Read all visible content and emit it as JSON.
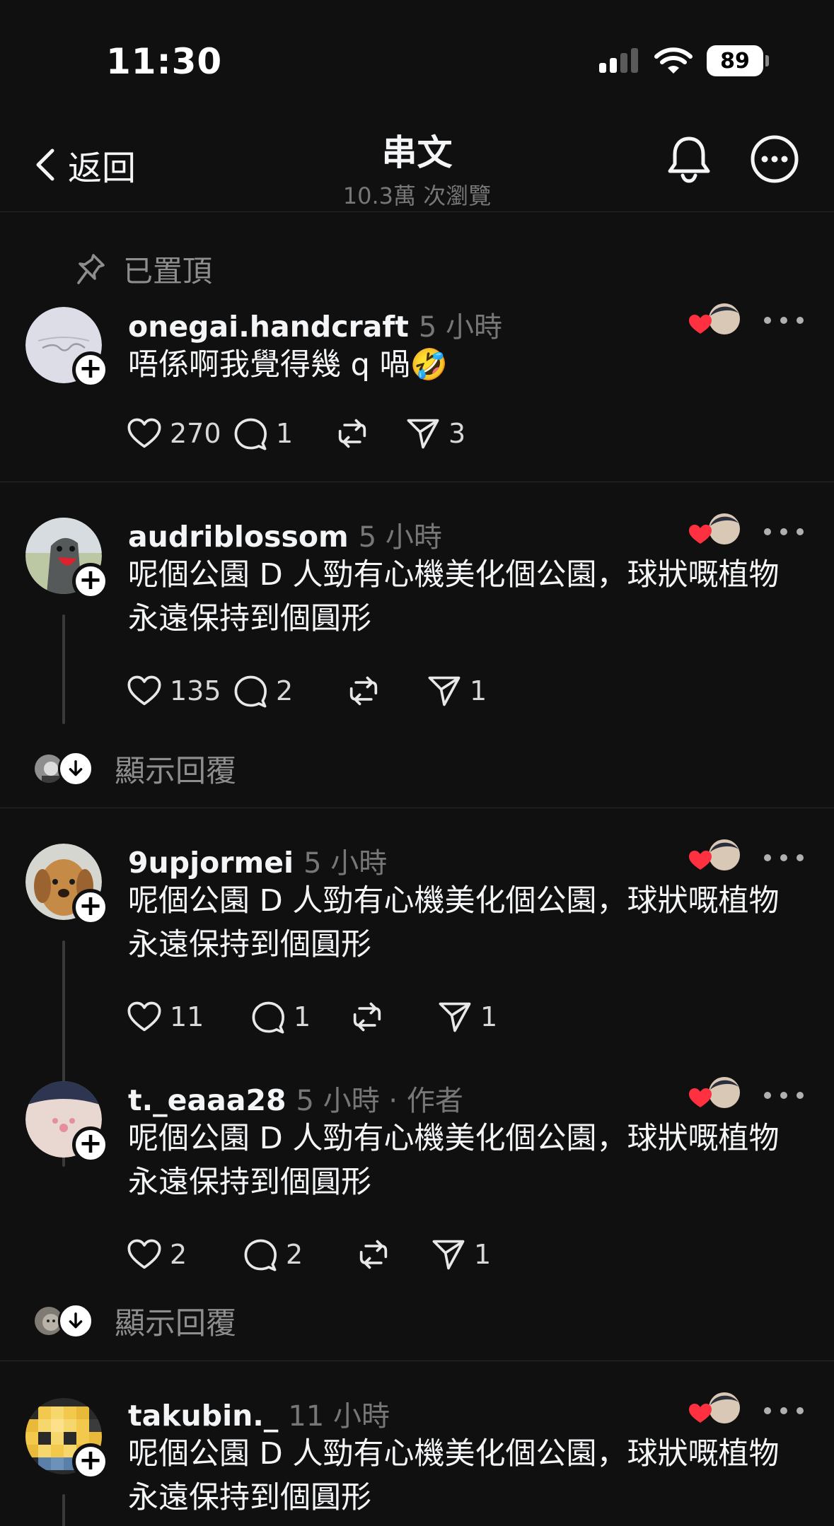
{
  "status_bar": {
    "time": "11:30",
    "battery": "89"
  },
  "nav": {
    "back_label": "返回",
    "title": "串文",
    "views": "10.3萬 次瀏覽"
  },
  "pinned_label": "已置頂",
  "posts": [
    {
      "username": "onegai.handcraft",
      "time": "5 小時",
      "text": "唔係啊我覺得幾 q 喎🤣",
      "likes": "270",
      "comments": "1",
      "reposts": "",
      "shares": "3"
    },
    {
      "username": "audriblossom",
      "time": "5 小時",
      "text": "呢個公園 D 人勁有心機美化個公園，球狀嘅植物永遠保持到個圓形",
      "likes": "135",
      "comments": "2",
      "reposts": "",
      "shares": "1"
    },
    {
      "username": "9upjormei",
      "time": "5 小時",
      "text": "呢個公園 D 人勁有心機美化個公園，球狀嘅植物永遠保持到個圓形",
      "likes": "11",
      "comments": "1",
      "reposts": "",
      "shares": "1"
    },
    {
      "username": "t._eaaa28",
      "time": "5 小時 · 作者",
      "text": "呢個公園 D 人勁有心機美化個公園，球狀嘅植物永遠保持到個圓形",
      "likes": "2",
      "comments": "2",
      "reposts": "",
      "shares": "1"
    },
    {
      "username": "takubin._",
      "time": "11 小時",
      "text": "呢個公園 D 人勁有心機美化個公園，球狀嘅植物永遠保持到個圓形"
    }
  ],
  "show_replies_label": "顯示回覆",
  "colors": {
    "background": "#101010",
    "text": "#f3f5f7",
    "muted": "#777777",
    "heart": "#ff3040"
  },
  "icons": [
    "chevron-left-icon",
    "bell-icon",
    "more-circle-icon",
    "pin-icon",
    "heart-icon",
    "comment-icon",
    "repost-icon",
    "share-icon",
    "plus-icon",
    "arrow-down-icon"
  ]
}
